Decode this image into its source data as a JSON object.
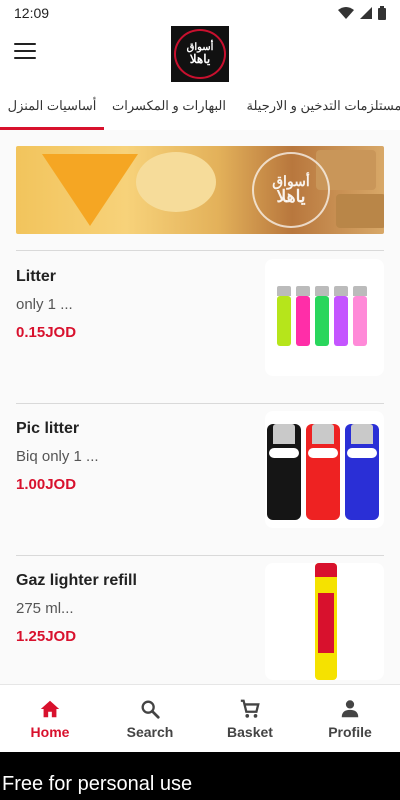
{
  "status_bar": {
    "time": "12:09"
  },
  "app_bar": {
    "logo_line1": "أسواق",
    "logo_line2": "ياهلا"
  },
  "tabs": [
    {
      "label": "أساسيات المنزل",
      "active": true
    },
    {
      "label": "البهارات و المكسرات",
      "active": false
    },
    {
      "label": "مستلزمات التدخين و الارجيلة",
      "active": false
    }
  ],
  "banner": {
    "logo_line1": "أسواق",
    "logo_line2": "ياهلا"
  },
  "products": [
    {
      "name": "Litter",
      "description": "only 1 ...",
      "price": "0.15JOD"
    },
    {
      "name": "Pic litter",
      "description": "Biq only 1 ...",
      "price": "1.00JOD"
    },
    {
      "name": "Gaz lighter refill",
      "description": "275 ml...",
      "price": "1.25JOD"
    }
  ],
  "bottom_nav": [
    {
      "label": "Home",
      "icon": "home-icon",
      "active": true
    },
    {
      "label": "Search",
      "icon": "search-icon",
      "active": false
    },
    {
      "label": "Basket",
      "icon": "cart-icon",
      "active": false
    },
    {
      "label": "Profile",
      "icon": "person-icon",
      "active": false
    }
  ],
  "watermark": "Free for personal use",
  "colors": {
    "accent": "#d8112d",
    "background": "#fafafa"
  }
}
